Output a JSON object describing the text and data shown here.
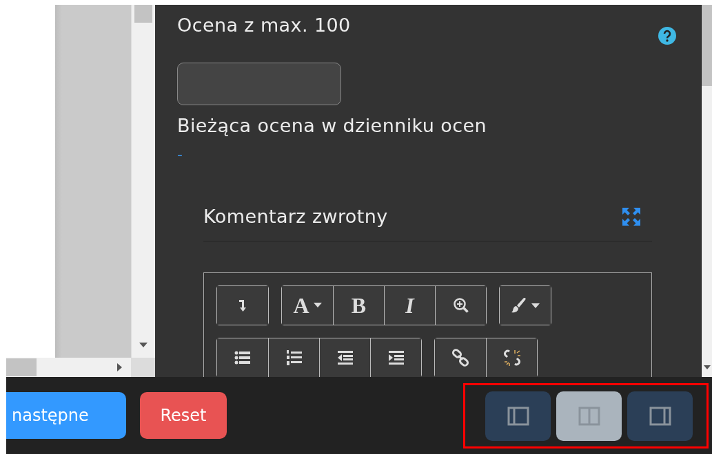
{
  "grade": {
    "label": "Ocena z max. 100"
  },
  "current_grade": {
    "label": "Bieżąca ocena w dzienniku ocen",
    "value": "-"
  },
  "feedback": {
    "title": "Komentarz zwrotny",
    "toolbar_rows": [
      [
        [
          {
            "kind": "insert"
          }
        ],
        [
          {
            "kind": "font",
            "label": "A"
          },
          {
            "kind": "bold",
            "label": "B"
          },
          {
            "kind": "italic",
            "label": "I"
          },
          {
            "kind": "zoom"
          }
        ],
        [
          {
            "kind": "brush"
          }
        ]
      ],
      [
        [
          {
            "kind": "bullets"
          },
          {
            "kind": "numbers"
          },
          {
            "kind": "outdent"
          },
          {
            "kind": "indent"
          }
        ],
        [
          {
            "kind": "link"
          },
          {
            "kind": "unlink"
          }
        ]
      ]
    ]
  },
  "footer": {
    "buttons": [
      {
        "kind": "primary",
        "label": "następne"
      },
      {
        "kind": "danger",
        "label": "Reset"
      }
    ],
    "layout_switch": {
      "highlighted": true,
      "options": [
        {
          "kind": "left",
          "selected": false
        },
        {
          "kind": "both",
          "selected": true
        },
        {
          "kind": "right",
          "selected": false
        }
      ]
    }
  }
}
